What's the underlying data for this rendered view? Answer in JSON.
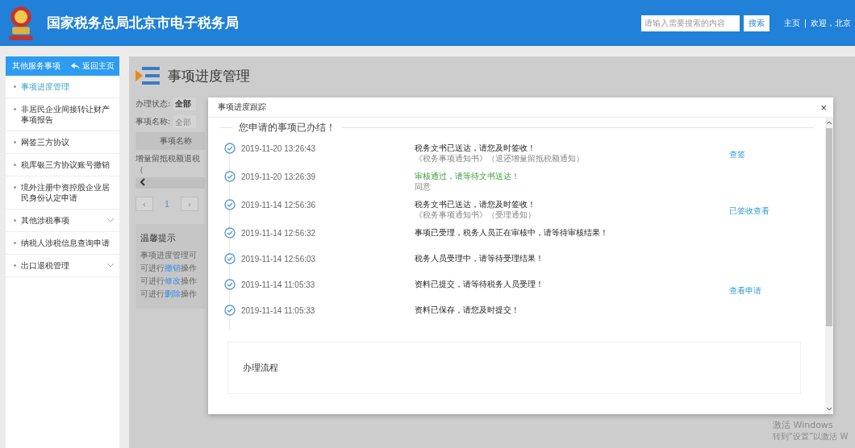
{
  "header": {
    "title": "国家税务总局北京市电子税务局",
    "search": {
      "placeholder": "请输入需要搜索的内容",
      "button": "搜索"
    },
    "nav": [
      "主页",
      "|",
      "欢迎，北京"
    ]
  },
  "sidebar": {
    "heading": "其他服务事项",
    "back_link": "返回主页",
    "items": [
      {
        "label": "事项进度管理",
        "selected": true,
        "has_children": false
      },
      {
        "label": "非居民企业间接转让财产事项报告",
        "selected": false,
        "has_children": false
      },
      {
        "label": "网签三方协议",
        "selected": false,
        "has_children": false
      },
      {
        "label": "税库银三方协议账号撤销",
        "selected": false,
        "has_children": false
      },
      {
        "label": "境外注册中资控股企业居民身份认定申请",
        "selected": false,
        "has_children": false
      },
      {
        "label": "其他涉税事项",
        "selected": false,
        "has_children": true
      },
      {
        "label": "纳税人涉税信息查询申请",
        "selected": false,
        "has_children": false
      },
      {
        "label": "出口退税管理",
        "selected": false,
        "has_children": true
      }
    ]
  },
  "main": {
    "title": "事项进度管理",
    "filters": [
      {
        "label": "办理状态:",
        "value": "全部"
      },
      {
        "label": "事项名称:",
        "placeholder": "全部"
      }
    ],
    "table": {
      "columns": [
        "事项名称"
      ],
      "rows": [
        [
          "增量留抵税额退税（"
        ]
      ]
    },
    "pagination": {
      "prev": "‹",
      "next": "›",
      "pages": [
        {
          "label": "1",
          "selected": true
        }
      ]
    },
    "tips": {
      "title": "温馨提示",
      "lines": [
        {
          "before": "事项进度管理可"
        },
        {
          "before": "可进行",
          "link": "撤销",
          "after": "操作"
        },
        {
          "before": "可进行",
          "link": "修改",
          "after": "操作"
        },
        {
          "before": "可进行",
          "link": "删除",
          "after": "操作"
        }
      ]
    }
  },
  "dialog": {
    "title": "事项进度跟踪",
    "close": "×",
    "heading": "您申请的事项已办结！",
    "timeline": [
      {
        "time": "2019-11-20 13:26:43",
        "message": "税务文书已送达，请您及时签收！",
        "success": false,
        "note": "《税务事项通知书》（退还增量留抵税额通知）",
        "action": "查签"
      },
      {
        "time": "2019-11-20 13:26:39",
        "message": "审核通过，请等待文书送达！",
        "success": true,
        "note": "同意"
      },
      {
        "time": "2019-11-14 12:56:36",
        "message": "税务文书已送达，请您及时签收！",
        "success": false,
        "note": "《税务事项通知书》（受理通知）",
        "action": "已签收查看"
      },
      {
        "time": "2019-11-14 12:56:32",
        "message": "事项已受理，税务人员正在审核中，请等待审核结果！",
        "success": false
      },
      {
        "time": "2019-11-14 12:56:03",
        "message": "税务人员受理中，请等待受理结果！",
        "success": false
      },
      {
        "time": "2019-11-14 11:05:33",
        "message": "资料已提交，请等待税务人员受理！",
        "success": false,
        "action": "查看申请"
      },
      {
        "time": "2019-11-14 11:05:33",
        "message": "资料已保存，请您及时提交！",
        "success": false
      }
    ],
    "process_title": "办理流程"
  },
  "os_notice": [
    "激活 Windows",
    "转到“设置”以激活 W"
  ]
}
